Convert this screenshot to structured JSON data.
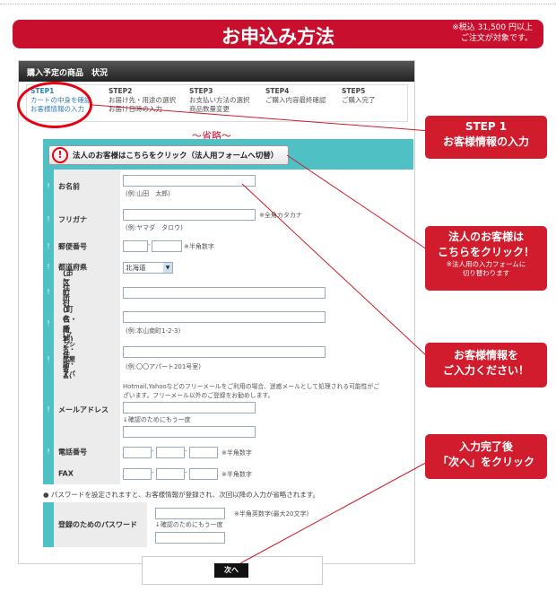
{
  "banner": {
    "title": "お申込み方法",
    "note_line1": "※税込 31,500 円以上",
    "note_line2": "ご注文が対象です。"
  },
  "panel": {
    "title": "購入予定の商品　状況"
  },
  "steps": [
    {
      "num": "STEP1",
      "line1": "カートの中身を確認",
      "line2": "お客様情報の入力"
    },
    {
      "num": "STEP2",
      "line1": "お届け先・用途の選択",
      "line2": "お届け日時の入力"
    },
    {
      "num": "STEP3",
      "line1": "お支払い方法の選択",
      "line2": "商品数量変更"
    },
    {
      "num": "STEP4",
      "line1": "ご購入内容最終確認",
      "line2": ""
    },
    {
      "num": "STEP5",
      "line1": "ご購入完了",
      "line2": ""
    }
  ],
  "omitted": "〜省略〜",
  "corporate_button": "法人のお客様はこちらをクリック（法人用フォームへ切替）",
  "form": {
    "mark": "!",
    "name_label": "お名前",
    "name_hint": "(例:山田　太郎)",
    "kana_label": "フリガナ",
    "kana_note": "※全角カタカナ",
    "kana_hint": "(例:ヤマダ　タロウ)",
    "zip_label": "郵便番号",
    "zip_note": "※半角数字",
    "pref_label": "都道府県",
    "pref_value": "北海道",
    "addr1_label": "ご住所1",
    "addr1_sub": "(市区町村郡)",
    "addr2_label": "ご住所2",
    "addr2_sub": "(町名・番地)",
    "addr2_hint": "(例:本山南町1-2-3)",
    "addr3_label": "ご住所3",
    "addr3_sub1": "(マンション・アパー",
    "addr3_sub2": "ト名・部屋番号)",
    "addr3_hint": "(例:〇〇アパート201号室)",
    "mail_label": "メールアドレス",
    "mail_note1": "Hotmail,Yahooなどのフリーメールをご利用の場合、迷惑メールとして処理される可能性がご",
    "mail_note2": "ざいます。フリーメール以外のご登録をお勧めします。",
    "mail_confirm": "↓確認のためにもう一度",
    "tel_label": "電話番号",
    "tel_note": "※半角数字",
    "fax_label": "FAX",
    "fax_note": "※半角数字",
    "pw_notice": "● パスワードを設定されますと、お客様情報が登録され、次回以降の入力が省略されます。",
    "pw_label": "登録のためのパスワード",
    "pw_note": "※半角英数字(最大20文字)",
    "pw_confirm": "↓確認のためにもう一度"
  },
  "next_button": "次へ",
  "callouts": {
    "c1_line1": "STEP 1",
    "c1_line2": "お客様情報の入力",
    "c2_line1": "法人のお客様は",
    "c2_line2": "こちらをクリック！",
    "c2_small1": "※法人用の入力フォームに",
    "c2_small2": "切り替わります",
    "c3_line1": "お客様情報を",
    "c3_line2": "ご入力ください！",
    "c4_line1": "入力完了後",
    "c4_line2": "「次へ」をクリック"
  },
  "colors": {
    "brand_red": "#c8102e",
    "teal": "#4fc1c4"
  }
}
